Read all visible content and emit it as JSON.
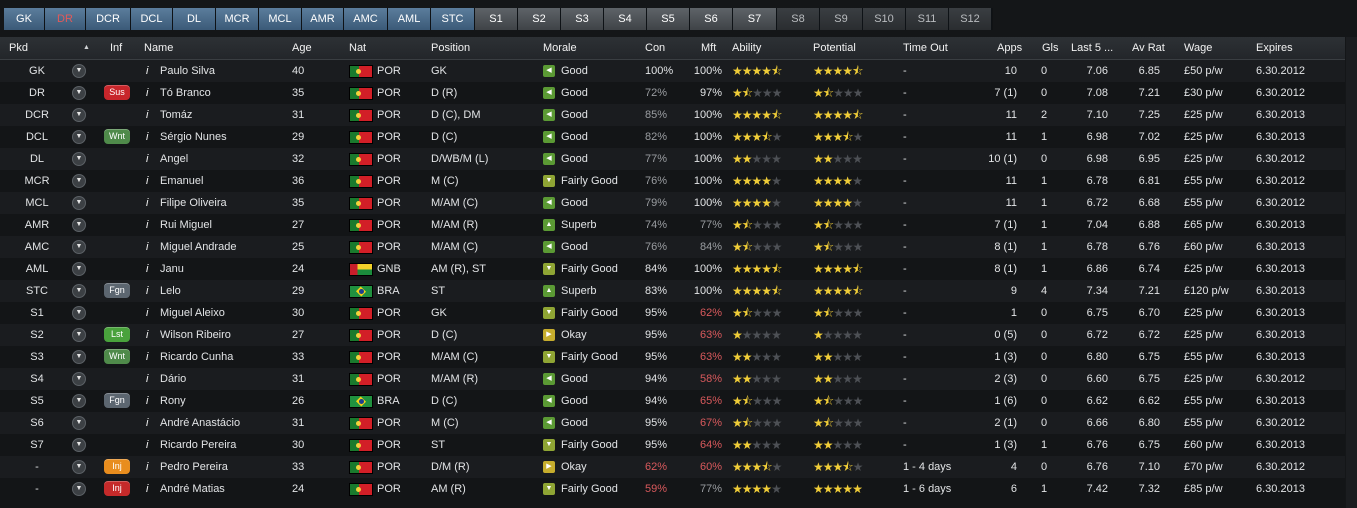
{
  "tabs": [
    {
      "label": "GK",
      "group": "main",
      "w": 41
    },
    {
      "label": "DR",
      "group": "main",
      "w": 41,
      "active": true
    },
    {
      "label": "DCR",
      "group": "main",
      "w": 45
    },
    {
      "label": "DCL",
      "group": "main",
      "w": 42
    },
    {
      "label": "DL",
      "group": "main",
      "w": 43
    },
    {
      "label": "MCR",
      "group": "main",
      "w": 43
    },
    {
      "label": "MCL",
      "group": "main",
      "w": 43
    },
    {
      "label": "AMR",
      "group": "main",
      "w": 42
    },
    {
      "label": "AMC",
      "group": "main",
      "w": 44
    },
    {
      "label": "AML",
      "group": "main",
      "w": 43
    },
    {
      "label": "STC",
      "group": "main",
      "w": 44
    },
    {
      "label": "S1",
      "group": "sub",
      "w": 43
    },
    {
      "label": "S2",
      "group": "sub",
      "w": 43
    },
    {
      "label": "S3",
      "group": "sub",
      "w": 43
    },
    {
      "label": "S4",
      "group": "sub",
      "w": 43
    },
    {
      "label": "S5",
      "group": "sub",
      "w": 43
    },
    {
      "label": "S6",
      "group": "sub",
      "w": 43
    },
    {
      "label": "S7",
      "group": "sub",
      "w": 44
    },
    {
      "label": "S8",
      "group": "bench",
      "w": 43
    },
    {
      "label": "S9",
      "group": "bench",
      "w": 43
    },
    {
      "label": "S10",
      "group": "bench",
      "w": 43
    },
    {
      "label": "S11",
      "group": "bench",
      "w": 43
    },
    {
      "label": "S12",
      "group": "bench",
      "w": 43
    }
  ],
  "headers": {
    "pkd": "Pkd",
    "inf": "Inf",
    "name": "Name",
    "age": "Age",
    "nat": "Nat",
    "position": "Position",
    "morale": "Morale",
    "con": "Con",
    "mft": "Mft",
    "ability": "Ability",
    "potential": "Potential",
    "timeout": "Time Out",
    "apps": "Apps",
    "gls": "Gls",
    "last5": "Last 5 ...",
    "avrat": "Av Rat",
    "wage": "Wage",
    "expires": "Expires"
  },
  "sort_indicator": "▲",
  "colors": {
    "sus": "#c8262b",
    "wnt": "#4f8a4a",
    "fgn": "#5c6670",
    "lst": "#49a23c",
    "inj_orange": "#e88d1e",
    "inj_red": "#c52a2a"
  },
  "players": [
    {
      "pkd": "GK",
      "inf": "",
      "name": "Paulo Silva",
      "age": "40",
      "flag": "POR",
      "nat": "POR",
      "pos": "GK",
      "morale": "Good",
      "mt": "good",
      "con": "100%",
      "mft": "100%",
      "ab": 4.5,
      "po": 4.5,
      "time": "-",
      "apps": "10",
      "gls": "0",
      "last5": "7.06",
      "avrat": "6.85",
      "wage": "£50 p/w",
      "exp": "6.30.2012"
    },
    {
      "pkd": "DR",
      "inf": "Sus",
      "infc": "sus",
      "name": "Tó Branco",
      "age": "35",
      "flag": "POR",
      "nat": "POR",
      "pos": "D (R)",
      "morale": "Good",
      "mt": "good",
      "con": "72%",
      "condim": true,
      "mft": "97%",
      "ab": 1.5,
      "po": 1.5,
      "time": "-",
      "apps": "7 (1)",
      "gls": "0",
      "last5": "7.08",
      "avrat": "7.21",
      "wage": "£30 p/w",
      "exp": "6.30.2012"
    },
    {
      "pkd": "DCR",
      "inf": "",
      "name": "Tomáz",
      "age": "31",
      "flag": "POR",
      "nat": "POR",
      "pos": "D (C), DM",
      "morale": "Good",
      "mt": "good",
      "con": "85%",
      "condim": true,
      "mft": "100%",
      "ab": 4.5,
      "po": 4.5,
      "time": "-",
      "apps": "11",
      "gls": "2",
      "last5": "7.10",
      "avrat": "7.25",
      "wage": "£25 p/w",
      "exp": "6.30.2013"
    },
    {
      "pkd": "DCL",
      "inf": "Wnt",
      "infc": "wnt",
      "name": "Sérgio Nunes",
      "age": "29",
      "flag": "POR",
      "nat": "POR",
      "pos": "D (C)",
      "morale": "Good",
      "mt": "good",
      "con": "82%",
      "condim": true,
      "mft": "100%",
      "ab": 3.5,
      "po": 3.5,
      "time": "-",
      "apps": "11",
      "gls": "1",
      "last5": "6.98",
      "avrat": "7.02",
      "wage": "£25 p/w",
      "exp": "6.30.2013"
    },
    {
      "pkd": "DL",
      "inf": "",
      "name": "Angel",
      "age": "32",
      "flag": "POR",
      "nat": "POR",
      "pos": "D/WB/M (L)",
      "morale": "Good",
      "mt": "good",
      "con": "77%",
      "condim": true,
      "mft": "100%",
      "ab": 2,
      "po": 2,
      "time": "-",
      "apps": "10 (1)",
      "gls": "0",
      "last5": "6.98",
      "avrat": "6.95",
      "wage": "£25 p/w",
      "exp": "6.30.2012"
    },
    {
      "pkd": "MCR",
      "inf": "",
      "name": "Emanuel",
      "age": "36",
      "flag": "POR",
      "nat": "POR",
      "pos": "M (C)",
      "morale": "Fairly Good",
      "mt": "fg",
      "con": "76%",
      "condim": true,
      "mft": "100%",
      "ab": 4,
      "po": 4,
      "time": "-",
      "apps": "11",
      "gls": "1",
      "last5": "6.78",
      "avrat": "6.81",
      "wage": "£55 p/w",
      "exp": "6.30.2012"
    },
    {
      "pkd": "MCL",
      "inf": "",
      "name": "Filipe Oliveira",
      "age": "35",
      "flag": "POR",
      "nat": "POR",
      "pos": "M/AM (C)",
      "morale": "Good",
      "mt": "good",
      "con": "79%",
      "condim": true,
      "mft": "100%",
      "ab": 4,
      "po": 4,
      "time": "-",
      "apps": "11",
      "gls": "1",
      "last5": "6.72",
      "avrat": "6.68",
      "wage": "£55 p/w",
      "exp": "6.30.2012"
    },
    {
      "pkd": "AMR",
      "inf": "",
      "name": "Rui Miguel",
      "age": "27",
      "flag": "POR",
      "nat": "POR",
      "pos": "M/AM (R)",
      "morale": "Superb",
      "mt": "good",
      "con": "74%",
      "condim": true,
      "mft": "77%",
      "mftdim": true,
      "ab": 1.5,
      "po": 1.5,
      "time": "-",
      "apps": "7 (1)",
      "gls": "1",
      "last5": "7.04",
      "avrat": "6.88",
      "wage": "£65 p/w",
      "exp": "6.30.2013"
    },
    {
      "pkd": "AMC",
      "inf": "",
      "name": "Miguel Andrade",
      "age": "25",
      "flag": "POR",
      "nat": "POR",
      "pos": "M/AM (C)",
      "morale": "Good",
      "mt": "good",
      "con": "76%",
      "condim": true,
      "mft": "84%",
      "mftdim": true,
      "ab": 1.5,
      "po": 1.5,
      "time": "-",
      "apps": "8 (1)",
      "gls": "1",
      "last5": "6.78",
      "avrat": "6.76",
      "wage": "£60 p/w",
      "exp": "6.30.2013"
    },
    {
      "pkd": "AML",
      "inf": "",
      "name": "Janu",
      "age": "24",
      "flag": "GNB",
      "nat": "GNB",
      "pos": "AM (R), ST",
      "morale": "Fairly Good",
      "mt": "fg",
      "con": "84%",
      "mft": "100%",
      "ab": 4.5,
      "po": 4.5,
      "time": "-",
      "apps": "8 (1)",
      "gls": "1",
      "last5": "6.86",
      "avrat": "6.74",
      "wage": "£25 p/w",
      "exp": "6.30.2013"
    },
    {
      "pkd": "STC",
      "inf": "Fgn",
      "infc": "fgn",
      "name": "Lelo",
      "age": "29",
      "flag": "BRA",
      "nat": "BRA",
      "pos": "ST",
      "morale": "Superb",
      "mt": "good",
      "con": "83%",
      "mft": "100%",
      "ab": 4.5,
      "po": 4.5,
      "time": "-",
      "apps": "9",
      "gls": "4",
      "last5": "7.34",
      "avrat": "7.21",
      "wage": "£120 p/w",
      "exp": "6.30.2013"
    },
    {
      "pkd": "S1",
      "inf": "",
      "name": "Miguel Aleixo",
      "age": "30",
      "flag": "POR",
      "nat": "POR",
      "pos": "GK",
      "morale": "Fairly Good",
      "mt": "fg",
      "con": "95%",
      "mft": "62%",
      "mftwarn": true,
      "ab": 1.5,
      "po": 1.5,
      "time": "-",
      "apps": "1",
      "gls": "0",
      "last5": "6.75",
      "avrat": "6.70",
      "wage": "£25 p/w",
      "exp": "6.30.2013"
    },
    {
      "pkd": "S2",
      "inf": "Lst",
      "infc": "lst",
      "name": "Wilson Ribeiro",
      "age": "27",
      "flag": "POR",
      "nat": "POR",
      "pos": "D (C)",
      "morale": "Okay",
      "mt": "okay",
      "con": "95%",
      "mft": "63%",
      "mftwarn": true,
      "ab": 1,
      "po": 1,
      "time": "-",
      "apps": "0 (5)",
      "gls": "0",
      "last5": "6.72",
      "avrat": "6.72",
      "wage": "£25 p/w",
      "exp": "6.30.2013"
    },
    {
      "pkd": "S3",
      "inf": "Wnt",
      "infc": "wnt",
      "name": "Ricardo Cunha",
      "age": "33",
      "flag": "POR",
      "nat": "POR",
      "pos": "M/AM (C)",
      "morale": "Fairly Good",
      "mt": "fg",
      "con": "95%",
      "mft": "63%",
      "mftwarn": true,
      "ab": 2,
      "po": 2,
      "time": "-",
      "apps": "1 (3)",
      "gls": "0",
      "last5": "6.80",
      "avrat": "6.75",
      "wage": "£55 p/w",
      "exp": "6.30.2013"
    },
    {
      "pkd": "S4",
      "inf": "",
      "name": "Dário",
      "age": "31",
      "flag": "POR",
      "nat": "POR",
      "pos": "M/AM (R)",
      "morale": "Good",
      "mt": "good",
      "con": "94%",
      "mft": "58%",
      "mftwarn": true,
      "ab": 2,
      "po": 2,
      "time": "-",
      "apps": "2 (3)",
      "gls": "0",
      "last5": "6.60",
      "avrat": "6.75",
      "wage": "£25 p/w",
      "exp": "6.30.2012"
    },
    {
      "pkd": "S5",
      "inf": "Fgn",
      "infc": "fgn",
      "name": "Rony",
      "age": "26",
      "flag": "BRA",
      "nat": "BRA",
      "pos": "D (C)",
      "morale": "Good",
      "mt": "good",
      "con": "94%",
      "mft": "65%",
      "mftwarn": true,
      "ab": 1.5,
      "po": 1.5,
      "time": "-",
      "apps": "1 (6)",
      "gls": "0",
      "last5": "6.62",
      "avrat": "6.62",
      "wage": "£55 p/w",
      "exp": "6.30.2013"
    },
    {
      "pkd": "S6",
      "inf": "",
      "name": "André Anastácio",
      "age": "31",
      "flag": "POR",
      "nat": "POR",
      "pos": "M (C)",
      "morale": "Good",
      "mt": "good",
      "con": "95%",
      "mft": "67%",
      "mftwarn": true,
      "ab": 1.5,
      "po": 1.5,
      "time": "-",
      "apps": "2 (1)",
      "gls": "0",
      "last5": "6.66",
      "avrat": "6.80",
      "wage": "£55 p/w",
      "exp": "6.30.2012"
    },
    {
      "pkd": "S7",
      "inf": "",
      "name": "Ricardo Pereira",
      "age": "30",
      "flag": "POR",
      "nat": "POR",
      "pos": "ST",
      "morale": "Fairly Good",
      "mt": "fg",
      "con": "95%",
      "mft": "64%",
      "mftwarn": true,
      "ab": 2,
      "po": 2,
      "time": "-",
      "apps": "1 (3)",
      "gls": "1",
      "last5": "6.76",
      "avrat": "6.75",
      "wage": "£60 p/w",
      "exp": "6.30.2013"
    },
    {
      "pkd": "-",
      "inf": "Inj",
      "infc": "inj_orange",
      "name": "Pedro Pereira",
      "age": "33",
      "flag": "POR",
      "nat": "POR",
      "pos": "D/M (R)",
      "morale": "Okay",
      "mt": "okay",
      "con": "62%",
      "conwarn": true,
      "mft": "60%",
      "mftwarn": true,
      "ab": 3.5,
      "po": 3.5,
      "time": "1 - 4 days",
      "apps": "4",
      "gls": "0",
      "last5": "6.76",
      "avrat": "7.10",
      "wage": "£70 p/w",
      "exp": "6.30.2012"
    },
    {
      "pkd": "-",
      "inf": "Inj",
      "infc": "inj_red",
      "name": "André Matias",
      "age": "24",
      "flag": "POR",
      "nat": "POR",
      "pos": "AM (R)",
      "morale": "Fairly Good",
      "mt": "fg",
      "con": "59%",
      "conwarn": true,
      "mft": "77%",
      "mftdim": true,
      "ab": 4,
      "po": 5,
      "time": "1 - 6 days",
      "apps": "6",
      "gls": "1",
      "last5": "7.42",
      "avrat": "7.32",
      "wage": "£85 p/w",
      "exp": "6.30.2013"
    }
  ]
}
